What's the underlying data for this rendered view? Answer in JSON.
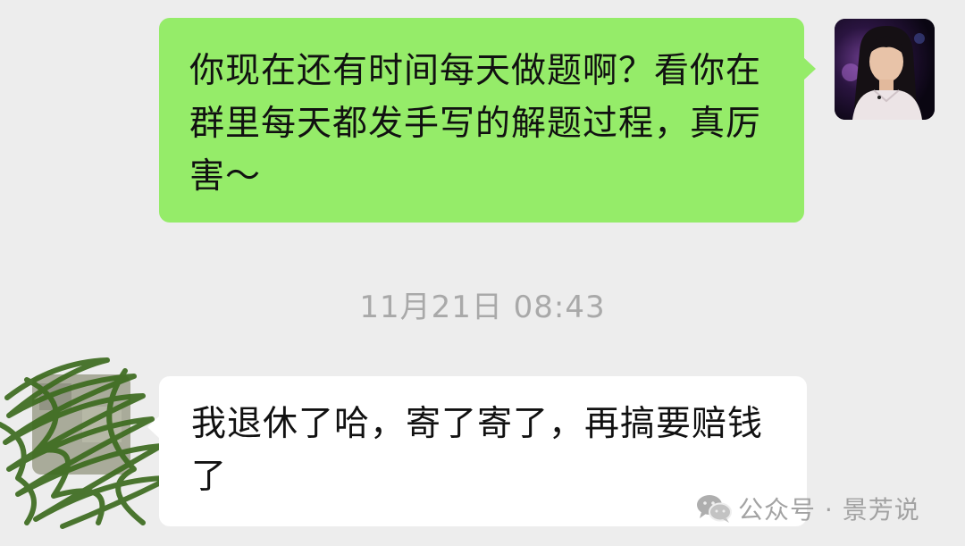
{
  "messages": {
    "outgoing": {
      "text": "你现在还有时间每天做题啊？看你在群里每天都发手写的解题过程，真厉害～"
    },
    "timestamp": "11月21日 08:43",
    "incoming": {
      "text": "我退休了哈，寄了寄了，再搞要赔钱了"
    }
  },
  "watermark": {
    "text": "公众号 · 景芳说",
    "icon": "wechat-icon"
  },
  "colors": {
    "background": "#ededed",
    "outgoing_bubble": "#95ec69",
    "incoming_bubble": "#ffffff",
    "timestamp_text": "#a9a9a9",
    "redaction_scribble": "#3d6b1f"
  }
}
